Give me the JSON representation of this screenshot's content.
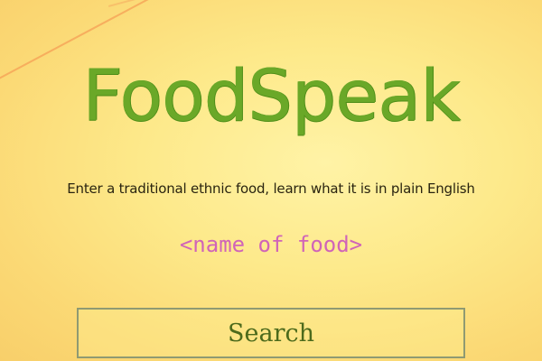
{
  "app": {
    "title": "FoodSpeak",
    "tagline": "Enter a traditional ethnic food, learn what it is in plain English"
  },
  "search": {
    "placeholder": "<name of food>",
    "value": "",
    "button_label": "Search"
  },
  "colors": {
    "background": "#fde98a",
    "title": "#6aa828",
    "placeholder": "#d064b8",
    "button_text": "#4c6a1c",
    "button_border": "#8f9a72"
  }
}
